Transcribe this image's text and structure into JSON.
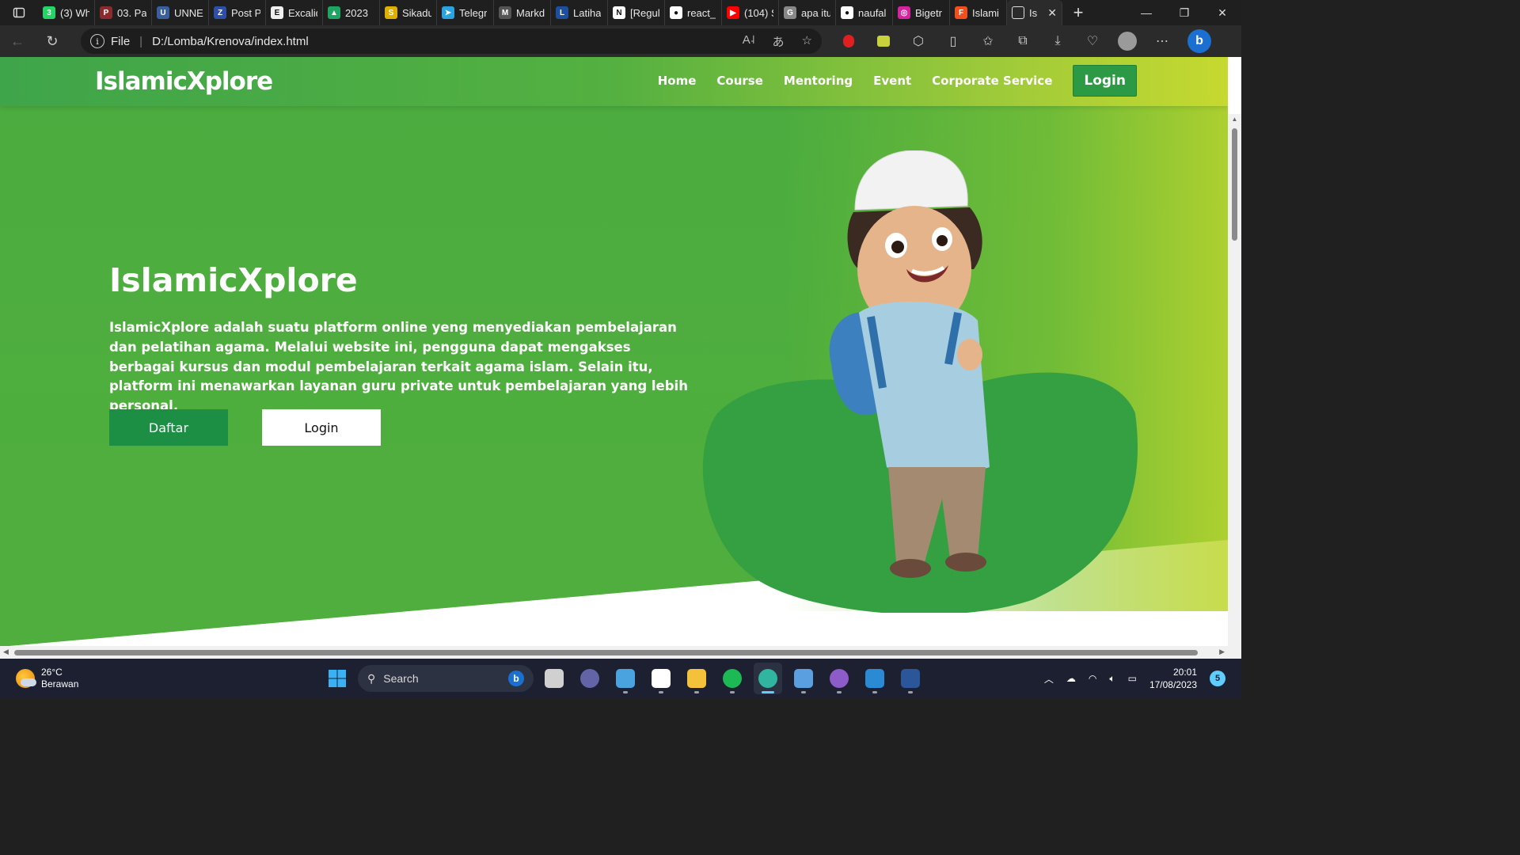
{
  "browser": {
    "tabs": [
      {
        "label": "(3) Wh",
        "icon": "whatsapp-icon",
        "color": "#25d366",
        "glyph": "3"
      },
      {
        "label": "03. Pa",
        "icon": "pdf-icon",
        "color": "#8b2b2b",
        "glyph": "P"
      },
      {
        "label": "UNNE",
        "icon": "unnes-icon",
        "color": "#3a5fa0",
        "glyph": "U"
      },
      {
        "label": "Post P",
        "icon": "zotero-icon",
        "color": "#2d4fa8",
        "glyph": "Z"
      },
      {
        "label": "Excalid",
        "icon": "excalidraw-icon",
        "color": "#f0f0f0",
        "glyph": "E"
      },
      {
        "label": "2023",
        "icon": "google-drive-icon",
        "color": "#1fa463",
        "glyph": "▲"
      },
      {
        "label": "Sikadu",
        "icon": "sikadu-icon",
        "color": "#e0b000",
        "glyph": "S"
      },
      {
        "label": "Telegr",
        "icon": "telegram-icon",
        "color": "#2aa3df",
        "glyph": "➤"
      },
      {
        "label": "Markd",
        "icon": "markdown-icon",
        "color": "#555555",
        "glyph": "M"
      },
      {
        "label": "Latiha",
        "icon": "latihan-icon",
        "color": "#1d4fa0",
        "glyph": "L"
      },
      {
        "label": "[Regul",
        "icon": "notion-icon",
        "color": "#ffffff",
        "glyph": "N"
      },
      {
        "label": "react_",
        "icon": "github-icon",
        "color": "#ffffff",
        "glyph": "●"
      },
      {
        "label": "(104) S",
        "icon": "youtube-icon",
        "color": "#ff0000",
        "glyph": "▶"
      },
      {
        "label": "apa itu",
        "icon": "google-icon",
        "color": "#888888",
        "glyph": "G"
      },
      {
        "label": "naufal",
        "icon": "github-icon",
        "color": "#ffffff",
        "glyph": "●"
      },
      {
        "label": "Bigetr",
        "icon": "instagram-icon",
        "color": "#d6249f",
        "glyph": "◎"
      },
      {
        "label": "Islami",
        "icon": "figma-icon",
        "color": "#f24e1e",
        "glyph": "F"
      }
    ],
    "active_tab": {
      "label": "Is",
      "icon": "page-icon"
    },
    "new_tab_glyph": "+",
    "url_prefix": "File",
    "url": "D:/Lomba/Krenova/index.html"
  },
  "site": {
    "logo": "IslamicXplore",
    "nav": [
      "Home",
      "Course",
      "Mentoring",
      "Event",
      "Corporate Service"
    ],
    "nav_login": "Login",
    "hero_title": "IslamicXplore",
    "hero_desc": "IslamicXplore adalah suatu platform online yeng menyediakan pembelajaran dan pelatihan agama. Melalui website ini, pengguna dapat mengakses berbagai kursus dan modul pembelajaran terkait agama islam. Selain itu, platform ini menawarkan layanan guru private untuk pembelajaran yang lebih personal.",
    "btn_primary": "Daftar",
    "btn_secondary": "Login",
    "colors": {
      "primary": "#4bac3f",
      "accent": "#c6d930",
      "blob": "#35a042",
      "button": "#1c8f45"
    }
  },
  "taskbar": {
    "weather_temp": "26°C",
    "weather_desc": "Berawan",
    "search_placeholder": "Search",
    "apps": [
      {
        "name": "task-view-icon",
        "color": "#d0d0d0"
      },
      {
        "name": "teams-icon",
        "color": "#6264a7"
      },
      {
        "name": "notepad-icon",
        "color": "#4aa3df"
      },
      {
        "name": "notion-icon",
        "color": "#ffffff"
      },
      {
        "name": "file-explorer-icon",
        "color": "#f3c13a"
      },
      {
        "name": "spotify-icon",
        "color": "#1db954"
      },
      {
        "name": "edge-icon",
        "color": "#2fb5a0"
      },
      {
        "name": "control-panel-icon",
        "color": "#5aa0e0"
      },
      {
        "name": "github-desktop-icon",
        "color": "#8e5cc9"
      },
      {
        "name": "vscode-icon",
        "color": "#2a8ad4"
      },
      {
        "name": "word-icon",
        "color": "#2b579a"
      }
    ],
    "time": "20:01",
    "date": "17/08/2023",
    "notifications": "5"
  }
}
